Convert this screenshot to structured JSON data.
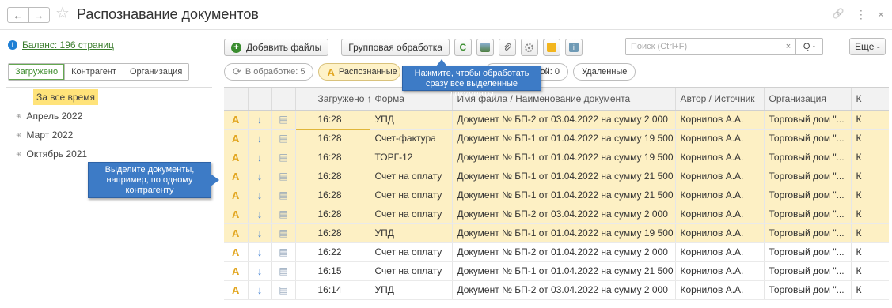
{
  "window": {
    "title": "Распознавание документов",
    "back_glyph": "←",
    "forward_glyph": "→",
    "star_glyph": "☆",
    "link_glyph": "🔗",
    "menu_glyph": "⋮",
    "close_glyph": "×"
  },
  "left": {
    "balance_label": "Баланс: 196 страниц",
    "tabs": [
      "Загружено",
      "Контрагент",
      "Организация"
    ],
    "tree": [
      {
        "label": "За все время",
        "selected": true
      },
      {
        "label": "Апрель 2022"
      },
      {
        "label": "Март 2022"
      },
      {
        "label": "Октябрь 2021"
      }
    ],
    "plus_glyph": "⊕"
  },
  "toolbar": {
    "add_files": "Добавить файлы",
    "group_processing": "Групповая обработка",
    "refresh_glyph": "C",
    "search_placeholder": "Поиск (Ctrl+F)",
    "search_clear": "×",
    "search_btn": "Q -",
    "more": "Еще -"
  },
  "status": {
    "in_processing": "В обработке: 5",
    "recognized": "Распознанные",
    "with_error": "С ошибкой: 0",
    "deleted": "Удаленные"
  },
  "callouts": {
    "group": "Нажмите, чтобы обработать сразу все выделенные документы",
    "select": "Выделите документы, например, по одному контрагенту"
  },
  "grid": {
    "columns": [
      "",
      "",
      "",
      "Загружено ↑",
      "Форма",
      "Имя файла / Наименование документа",
      "Автор / Источник",
      "Организация",
      "К"
    ],
    "rows": [
      {
        "hl": true,
        "time": "16:28",
        "form": "УПД",
        "name": "Документ № БП-2 от 03.04.2022 на сумму 2 000",
        "author": "Корнилов А.А.",
        "org": "Торговый дом \"...",
        "k": "К"
      },
      {
        "hl": true,
        "time": "16:28",
        "form": "Счет-фактура",
        "name": "Документ № БП-1 от 01.04.2022 на сумму 19 500",
        "author": "Корнилов А.А.",
        "org": "Торговый дом \"...",
        "k": "К"
      },
      {
        "hl": true,
        "time": "16:28",
        "form": "ТОРГ-12",
        "name": "Документ № БП-1 от 01.04.2022 на сумму 19 500",
        "author": "Корнилов А.А.",
        "org": "Торговый дом \"...",
        "k": "К"
      },
      {
        "hl": true,
        "time": "16:28",
        "form": "Счет на оплату",
        "name": "Документ № БП-1 от 01.04.2022 на сумму 21 500",
        "author": "Корнилов А.А.",
        "org": "Торговый дом \"...",
        "k": "К"
      },
      {
        "hl": true,
        "time": "16:28",
        "form": "Счет на оплату",
        "name": "Документ № БП-1 от 01.04.2022 на сумму 21 500",
        "author": "Корнилов А.А.",
        "org": "Торговый дом \"...",
        "k": "К"
      },
      {
        "hl": true,
        "time": "16:28",
        "form": "Счет на оплату",
        "name": "Документ № БП-2 от 03.04.2022 на сумму 2 000",
        "author": "Корнилов А.А.",
        "org": "Торговый дом \"...",
        "k": "К"
      },
      {
        "hl": true,
        "time": "16:28",
        "form": "УПД",
        "name": "Документ № БП-1 от 01.04.2022 на сумму 19 500",
        "author": "Корнилов А.А.",
        "org": "Торговый дом \"...",
        "k": "К"
      },
      {
        "hl": false,
        "time": "16:22",
        "form": "Счет на оплату",
        "name": "Документ № БП-2 от 01.04.2022 на сумму 2 000",
        "author": "Корнилов А.А.",
        "org": "Торговый дом \"...",
        "k": "К"
      },
      {
        "hl": false,
        "time": "16:15",
        "form": "Счет на оплату",
        "name": "Документ № БП-1 от 01.04.2022 на сумму 21 500",
        "author": "Корнилов А.А.",
        "org": "Торговый дом \"...",
        "k": "К"
      },
      {
        "hl": false,
        "time": "16:14",
        "form": "УПД",
        "name": "Документ № БП-2 от 03.04.2022 на сумму 2 000",
        "author": "Корнилов А.А.",
        "org": "Торговый дом \"...",
        "k": "К"
      }
    ],
    "icon_a": "A",
    "icon_down": "↓",
    "icon_file": "▤"
  },
  "colors": {
    "highlight": "#fdf0c4",
    "accent_green": "#3a8d2f",
    "callout_blue": "#3d7bc6"
  }
}
